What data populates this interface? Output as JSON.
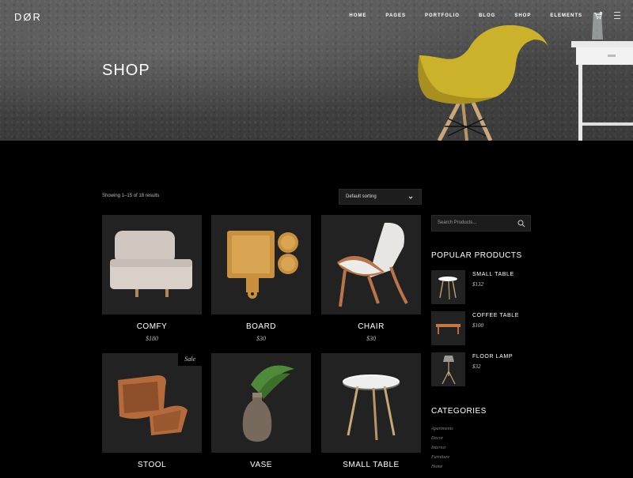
{
  "header": {
    "logo": "DØR",
    "nav": [
      "HOME",
      "PAGES",
      "PORTFOLIO",
      "BLOG",
      "SHOP",
      "ELEMENTS"
    ],
    "cart_count": "0",
    "icons": [
      "cart-icon",
      "menu-icon"
    ]
  },
  "hero": {
    "title": "SHOP"
  },
  "toolbar": {
    "results_text": "Showing 1–15 of 18 results",
    "sort_label": "Default sorting"
  },
  "products": [
    {
      "name": "COMFY",
      "price": "$180",
      "sale": ""
    },
    {
      "name": "BOARD",
      "price": "$30",
      "sale": ""
    },
    {
      "name": "CHAIR",
      "price": "$30",
      "sale": ""
    },
    {
      "name": "STOOL",
      "price": "",
      "sale": "Sale"
    },
    {
      "name": "VASE",
      "price": "",
      "sale": ""
    },
    {
      "name": "SMALL TABLE",
      "price": "",
      "sale": ""
    }
  ],
  "sidebar": {
    "search_placeholder": "Search Products...",
    "popular_title": "POPULAR PRODUCTS",
    "popular": [
      {
        "name": "SMALL TABLE",
        "price": "$132"
      },
      {
        "name": "COFFEE TABLE",
        "price": "$100"
      },
      {
        "name": "FLOOR LAMP",
        "price": "$32"
      }
    ],
    "categories_title": "CATEGORIES",
    "categories": [
      "Apartments",
      "Decor",
      "Interior",
      "Furniture",
      "Home"
    ]
  },
  "colors": {
    "background": "#000000",
    "card": "#222222",
    "text": "#ffffff",
    "muted": "#bbbbbb"
  }
}
